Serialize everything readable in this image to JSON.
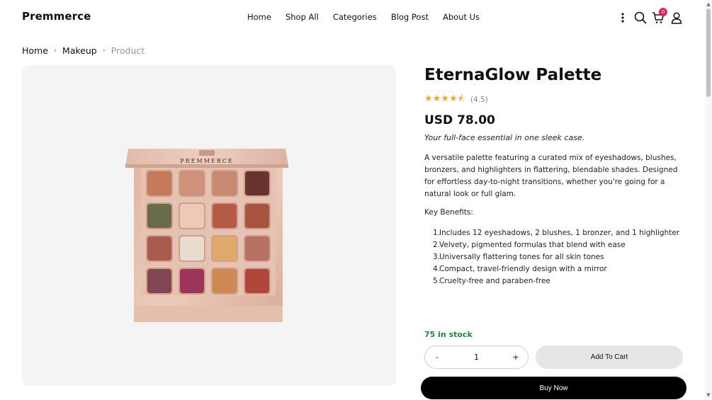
{
  "header": {
    "logo": "Premmerce",
    "nav": [
      "Home",
      "Shop All",
      "Categories",
      "Blog Post",
      "About Us"
    ],
    "icons": [
      "more-vertical-icon",
      "search-icon",
      "cart-icon",
      "user-icon"
    ],
    "cart_count": "0"
  },
  "breadcrumb": {
    "items": [
      "Home",
      "Makeup",
      "Product"
    ]
  },
  "product": {
    "title": "EternaGlow Palette",
    "rating_stars": 4.5,
    "rating_text": "(4.5)",
    "price": "USD 78.00",
    "tagline": "Your full-face essential in one sleek case.",
    "description": "A versatile palette featuring a curated mix of eyeshadows, blushes, bronzers, and highlighters in flattering, blendable shades. Designed for effortless day-to-night transitions, whether you're going for a natural look or full glam.",
    "benefits_label": "Key Benefits:",
    "benefits": [
      "Includes 12 eyeshadows, 2 blushes, 1 bronzer, and 1 highlighter",
      "Velvety, pigmented formulas that blend with ease",
      "Universally flattering tones for all skin tones",
      "Compact, travel-friendly design with a mirror",
      "Cruelty-free and paraben-free"
    ],
    "stock": "75 in stock",
    "palette_brand": "PREMMERCE"
  },
  "purchase": {
    "minus": "-",
    "quantity": "1",
    "plus": "+",
    "add_to_cart": "Add To Cart",
    "buy_now": "Buy Now"
  },
  "colors": {
    "accent_star": "#f5a623",
    "stock_green": "#1c8a3e",
    "badge_red": "#e0245e",
    "palette_case": "#e8c4b4",
    "swatches": [
      "#c67a5c",
      "#cf907c",
      "#c98a72",
      "#6b3330",
      "#6b6a4d",
      "#f0c8b6",
      "#b65a48",
      "#a7553f",
      "#a95c4d",
      "#e7dccd",
      "#e0a96c",
      "#b57265",
      "#834553",
      "#9c3559",
      "#cf8953",
      "#b0473d"
    ]
  }
}
